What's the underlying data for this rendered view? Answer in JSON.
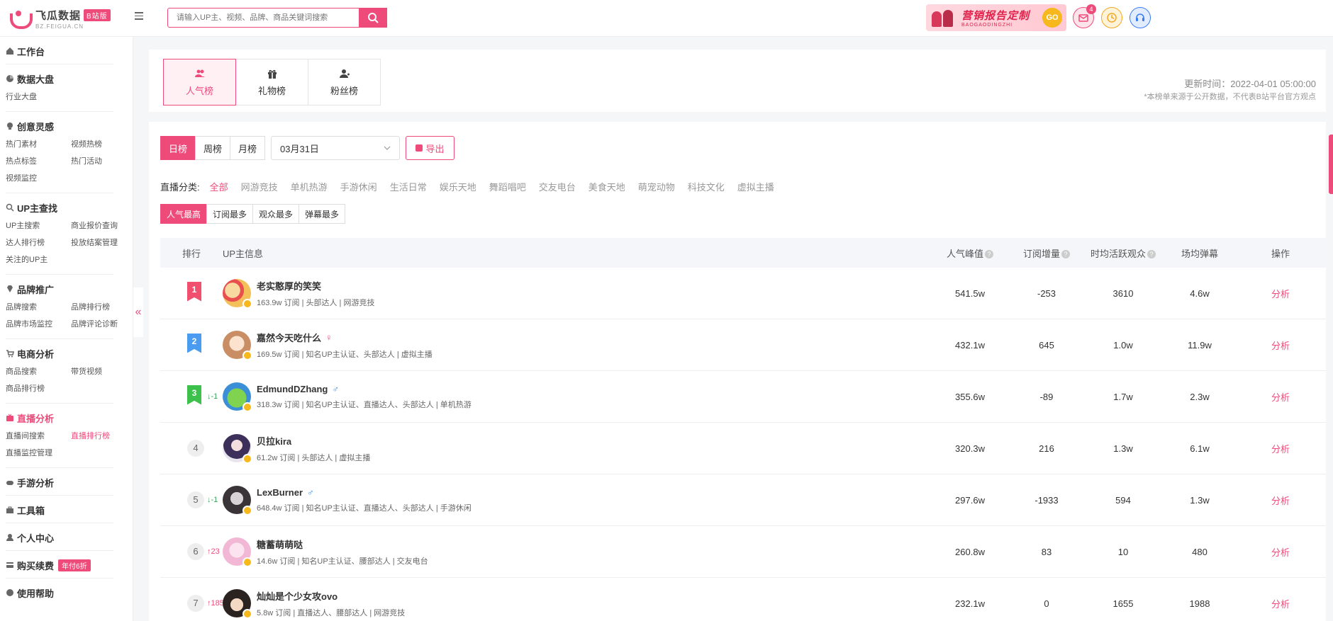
{
  "header": {
    "logo_name": "飞瓜数据",
    "logo_badge": "B站版",
    "logo_sub": "BZ.FEIGUA.CN",
    "search_placeholder": "请输入UP主、视频、品牌、商品关键词搜索",
    "promo_title": "营销报告定制",
    "promo_sub": "BAOGAODINGZHI",
    "promo_go": "GO",
    "mail_count": "4"
  },
  "sidebar": {
    "sections": [
      {
        "title": "工作台",
        "icon": "home-icon",
        "items": []
      },
      {
        "title": "数据大盘",
        "icon": "chart-pie-icon",
        "items": [
          "行业大盘"
        ]
      },
      {
        "title": "创意灵感",
        "icon": "bulb-icon",
        "items": [
          "热门素材",
          "视频热榜",
          "热点标签",
          "热门活动",
          "视频监控"
        ]
      },
      {
        "title": "UP主查找",
        "icon": "search-icon",
        "items": [
          "UP主搜索",
          "商业报价查询",
          "达人排行榜",
          "投放结案管理",
          "关注的UP主"
        ]
      },
      {
        "title": "品牌推广",
        "icon": "diamond-icon",
        "items": [
          "品牌搜索",
          "品牌排行榜",
          "品牌市场监控",
          "品牌评论诊断"
        ]
      },
      {
        "title": "电商分析",
        "icon": "cart-icon",
        "items": [
          "商品搜索",
          "带货视频",
          "商品排行榜"
        ]
      },
      {
        "title": "直播分析",
        "icon": "tv-icon",
        "items": [
          "直播间搜索",
          "直播排行榜",
          "直播监控管理"
        ]
      },
      {
        "title": "手游分析",
        "icon": "gamepad-icon",
        "items": []
      },
      {
        "title": "工具箱",
        "icon": "toolbox-icon",
        "items": []
      },
      {
        "title": "个人中心",
        "icon": "user-icon",
        "items": []
      },
      {
        "title": "购买续费",
        "icon": "card-icon",
        "items": [],
        "tag": "年付6折"
      },
      {
        "title": "使用帮助",
        "icon": "help-icon",
        "items": []
      }
    ],
    "active_section": "直播分析",
    "active_item": "直播排行榜",
    "toggle_glyph": "«"
  },
  "top_tabs": {
    "tabs": [
      "人气榜",
      "礼物榜",
      "粉丝榜"
    ],
    "active": 0,
    "update_time": "更新时间：2022-04-01 05:00:00",
    "note": "*本榜单来源于公开数据，不代表B站平台官方观点"
  },
  "filters": {
    "periods": [
      "日榜",
      "周榜",
      "月榜"
    ],
    "active_period": 0,
    "date": "03月31日",
    "export": "导出",
    "category_label": "直播分类:",
    "categories": [
      "全部",
      "网游竞技",
      "单机热游",
      "手游休闲",
      "生活日常",
      "娱乐天地",
      "舞蹈唱吧",
      "交友电台",
      "美食天地",
      "萌宠动物",
      "科技文化",
      "虚拟主播"
    ],
    "active_category": 0,
    "sorts": [
      "人气最高",
      "订阅最多",
      "观众最多",
      "弹幕最多"
    ],
    "active_sort": 0
  },
  "table": {
    "headers": {
      "rank": "排行",
      "info": "UP主信息",
      "popularity": "人气峰值",
      "subs": "订阅增量",
      "viewers": "时均活跃观众",
      "danmaku": "场均弹幕",
      "op": "操作"
    },
    "rows": [
      {
        "rank": "1",
        "change": "",
        "name": "老实憨厚的笑笑",
        "gender": "",
        "desc": "163.9w 订阅 | 头部达人 | 网游竞技",
        "pop": "541.5w",
        "subs": "-253",
        "viewers": "3610",
        "danmaku": "4.6w",
        "op": "分析"
      },
      {
        "rank": "2",
        "change": "",
        "name": "嘉然今天吃什么",
        "gender": "♀",
        "desc": "169.5w 订阅 | 知名UP主认证、头部达人 | 虚拟主播",
        "pop": "432.1w",
        "subs": "645",
        "viewers": "1.0w",
        "danmaku": "11.9w",
        "op": "分析"
      },
      {
        "rank": "3",
        "change": "↓-1",
        "name": "EdmundDZhang",
        "gender": "♂",
        "desc": "318.3w 订阅 | 知名UP主认证、直播达人、头部达人 | 单机热游",
        "pop": "355.6w",
        "subs": "-89",
        "viewers": "1.7w",
        "danmaku": "2.3w",
        "op": "分析"
      },
      {
        "rank": "4",
        "change": "",
        "name": "贝拉kira",
        "gender": "",
        "desc": "61.2w 订阅 | 头部达人 | 虚拟主播",
        "pop": "320.3w",
        "subs": "216",
        "viewers": "1.3w",
        "danmaku": "6.1w",
        "op": "分析"
      },
      {
        "rank": "5",
        "change": "↓-1",
        "name": "LexBurner",
        "gender": "♂",
        "desc": "648.4w 订阅 | 知名UP主认证、直播达人、头部达人 | 手游休闲",
        "pop": "297.6w",
        "subs": "-1933",
        "viewers": "594",
        "danmaku": "1.3w",
        "op": "分析"
      },
      {
        "rank": "6",
        "change": "↑23",
        "name": "糖蓄萌萌哒",
        "gender": "",
        "desc": "14.6w 订阅 | 知名UP主认证、腰部达人 | 交友电台",
        "pop": "260.8w",
        "subs": "83",
        "viewers": "10",
        "danmaku": "480",
        "op": "分析"
      },
      {
        "rank": "7",
        "change": "↑185",
        "name": "灿灿是个少女攻ovo",
        "gender": "",
        "desc": "5.8w 订阅 | 直播达人、腰部达人 | 网游竞技",
        "pop": "232.1w",
        "subs": "0",
        "viewers": "1655",
        "danmaku": "1988",
        "op": "分析"
      }
    ]
  },
  "colors": {
    "accent": "#ee4b7b",
    "rank1": "#f0506e",
    "rank2": "#4a9cf0",
    "rank3": "#3cc24c"
  }
}
